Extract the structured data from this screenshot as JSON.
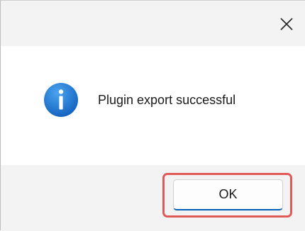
{
  "window": {
    "close_icon": "close-icon",
    "close_glyph": "✕"
  },
  "content": {
    "icon": "info-icon",
    "icon_color": "#1f7ad6",
    "message": "Plugin export successful"
  },
  "footer": {
    "ok_label": "OK"
  },
  "colors": {
    "highlight": "#e05a5a",
    "button_accent": "#005fb8"
  }
}
